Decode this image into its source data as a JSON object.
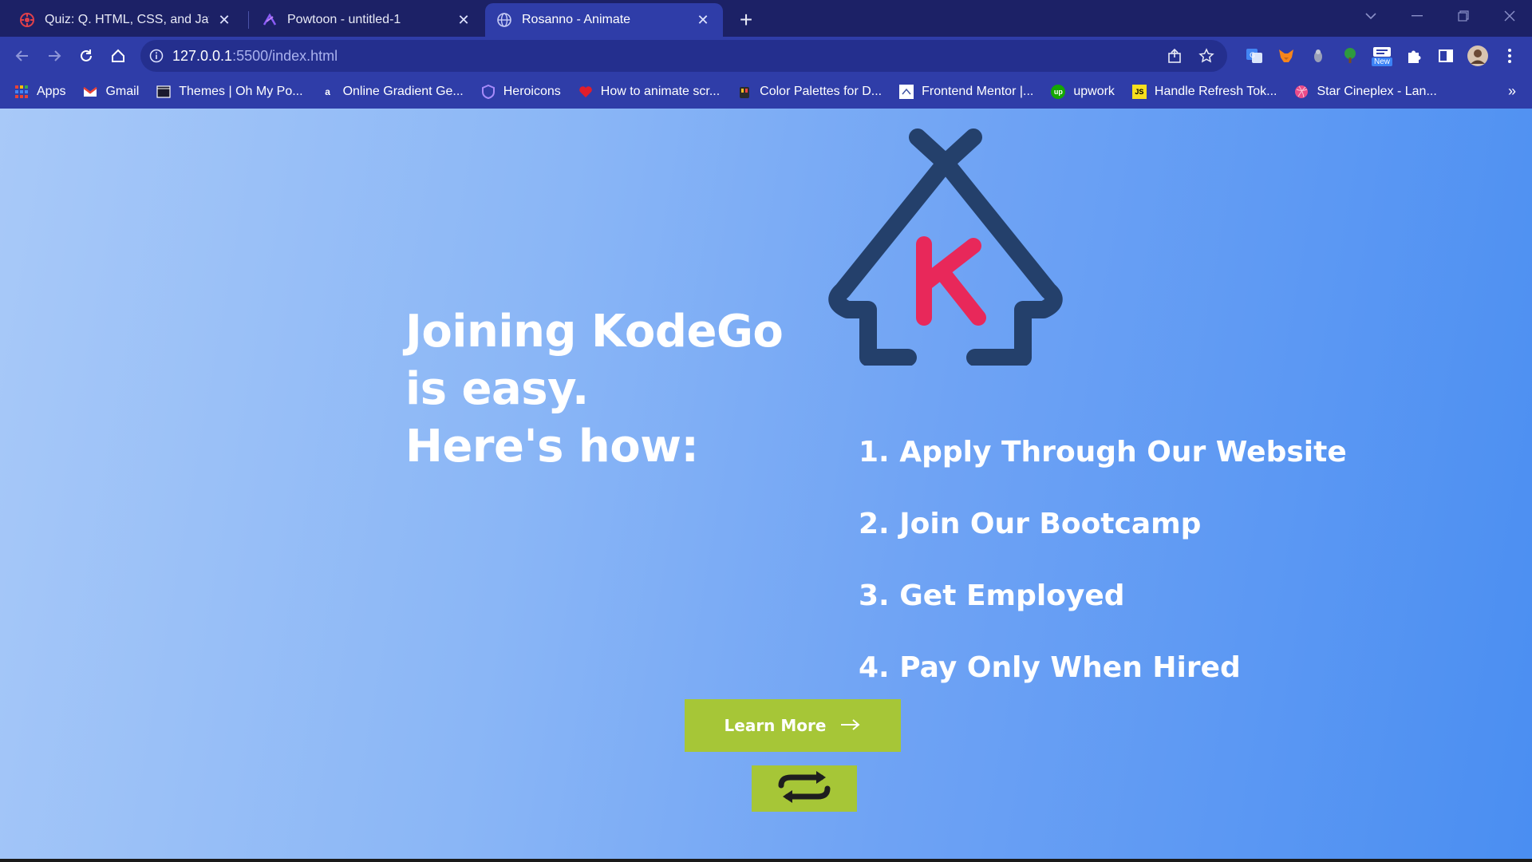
{
  "browser": {
    "tabs": [
      {
        "title": "Quiz: Q. HTML, CSS, and JavaScri",
        "icon": "quiz-favicon",
        "active": false
      },
      {
        "title": "Powtoon - untitled-1",
        "icon": "powtoon-favicon",
        "active": false
      },
      {
        "title": "Rosanno - Animate",
        "icon": "globe-favicon",
        "active": true
      }
    ],
    "new_tab_label": "+",
    "url_host": "127.0.0.1",
    "url_path": ":5500/index.html",
    "extension_badge": "New",
    "bookmarks": [
      {
        "label": "Apps",
        "icon": "apps-grid-icon"
      },
      {
        "label": "Gmail",
        "icon": "gmail-icon"
      },
      {
        "label": "Themes | Oh My Po...",
        "icon": "terminal-icon"
      },
      {
        "label": "Online Gradient Ge...",
        "icon": "gradient-icon"
      },
      {
        "label": "Heroicons",
        "icon": "shield-icon"
      },
      {
        "label": "How to animate scr...",
        "icon": "heart-icon"
      },
      {
        "label": "Color Palettes for D...",
        "icon": "palette-icon"
      },
      {
        "label": "Frontend Mentor |...",
        "icon": "frontend-mentor-icon"
      },
      {
        "label": "upwork",
        "icon": "upwork-icon"
      },
      {
        "label": "Handle Refresh Tok...",
        "icon": "js-icon"
      },
      {
        "label": "Star Cineplex - Lan...",
        "icon": "dribbble-icon"
      }
    ],
    "bookmark_overflow": "»"
  },
  "page": {
    "headline": [
      "Joining KodeGo",
      "is easy.",
      "Here's how:"
    ],
    "logo_letter": "K",
    "steps": [
      "1. Apply Through Our Website",
      "2. Join Our Bootcamp",
      "3. Get Employed",
      "4. Pay Only When Hired"
    ],
    "learn_more_label": "Learn More",
    "colors": {
      "logo_house": "#24406b",
      "logo_letter": "#e8285a",
      "button": "#a6c637",
      "gradient_start": "#a8c9f8",
      "gradient_end": "#4a8ef2"
    }
  }
}
